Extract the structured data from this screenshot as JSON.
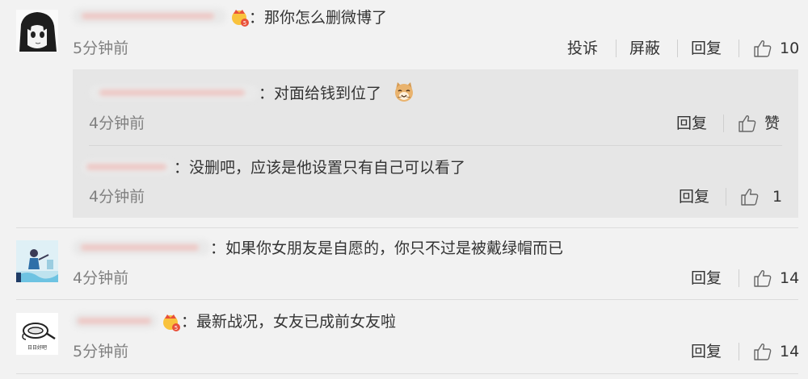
{
  "comments": [
    {
      "text": "：那你怎么删微博了",
      "time": "5分钟前",
      "actions": [
        "投诉",
        "屏蔽",
        "回复"
      ],
      "likes": "10",
      "replies": [
        {
          "text": "：对面给钱到位了",
          "time": "4分钟前",
          "reply_label": "回复",
          "likes": "赞"
        },
        {
          "text": "：没删吧，应该是他设置只有自己可以看了",
          "time": "4分钟前",
          "reply_label": "回复",
          "likes": "1"
        }
      ]
    },
    {
      "text": "：如果你女朋友是自愿的，你只不过是被戴绿帽而已",
      "time": "4分钟前",
      "reply_label": "回复",
      "likes": "14"
    },
    {
      "text": "：最新战况，女友已成前女友啦",
      "time": "5分钟前",
      "reply_label": "回复",
      "likes": "14",
      "avatar_caption": "日日好吧"
    }
  ],
  "colors": {
    "page_bg": "#f2f2f2",
    "reply_bg": "#e6e6e6",
    "muted": "#808080",
    "text": "#333333"
  },
  "icons": [
    "thumbs-up-icon",
    "crown-badge-icon",
    "cat-emoji-icon"
  ]
}
